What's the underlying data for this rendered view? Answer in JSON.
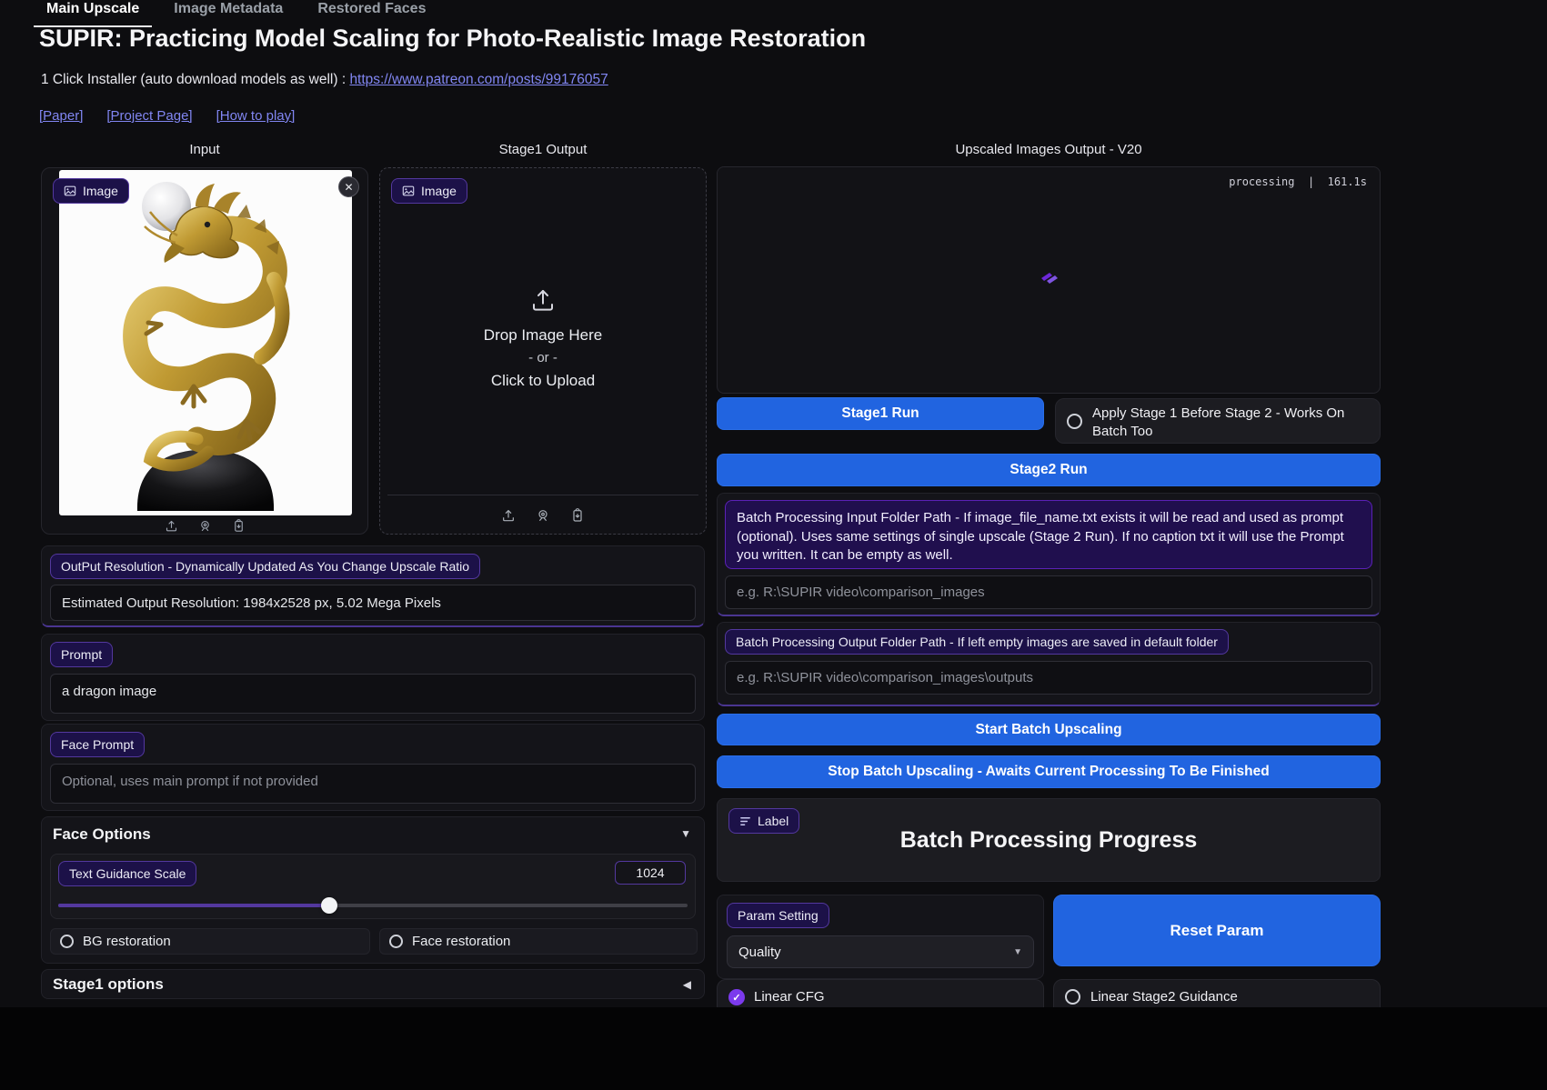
{
  "colors": {
    "accent_blue": "#2164e0",
    "accent_purple": "#7c3aed",
    "link": "#8186f2",
    "badge_bg": "#1c1148"
  },
  "tabs": [
    {
      "label": "Main Upscale",
      "active": true
    },
    {
      "label": "Image Metadata",
      "active": false
    },
    {
      "label": "Restored Faces",
      "active": false
    }
  ],
  "header": {
    "title": "SUPIR: Practicing Model Scaling for Photo-Realistic Image Restoration",
    "installer_text": "1 Click Installer (auto download models as well) : ",
    "installer_link": "https://www.patreon.com/posts/99176057",
    "links": [
      "[Paper]",
      "[Project Page]",
      "[How to play]"
    ]
  },
  "columns": {
    "input_label": "Input",
    "stage1_label": "Stage1 Output",
    "output_label": "Upscaled Images Output - V20"
  },
  "input_panel": {
    "badge": "Image"
  },
  "stage1_panel": {
    "badge": "Image",
    "drop_text": "Drop Image Here",
    "or_text": "- or -",
    "click_text": "Click to Upload"
  },
  "output_panel": {
    "status": "processing",
    "separator": "|",
    "time": "161.1s"
  },
  "resolution": {
    "badge": "OutPut Resolution - Dynamically Updated As You Change Upscale Ratio",
    "value": "Estimated Output Resolution: 1984x2528 px, 5.02 Mega Pixels"
  },
  "prompt": {
    "badge": "Prompt",
    "value": "a dragon image"
  },
  "face_prompt": {
    "badge": "Face Prompt",
    "placeholder": "Optional, uses main prompt if not provided"
  },
  "face_options": {
    "title": "Face Options",
    "tgs_badge": "Text Guidance Scale",
    "tgs_value": "1024",
    "slider_percent": 43,
    "bg_restoration": "BG restoration",
    "face_restoration": "Face restoration"
  },
  "stage1_options": {
    "title": "Stage1 options"
  },
  "buttons": {
    "stage1_run": "Stage1 Run",
    "stage2_run": "Stage2 Run",
    "start_batch": "Start Batch Upscaling",
    "stop_batch": "Stop Batch Upscaling - Awaits Current Processing To Be Finished",
    "reset_param": "Reset Param"
  },
  "apply_stage1": {
    "label": "Apply Stage 1 Before Stage 2 - Works On Batch Too"
  },
  "batch_input": {
    "info": "Batch Processing Input Folder Path - If image_file_name.txt exists it will be read and used as prompt (optional). Uses same settings of single upscale (Stage 2 Run). If no caption txt it will use the Prompt you written. It can be empty as well.",
    "placeholder": "e.g. R:\\SUPIR video\\comparison_images"
  },
  "batch_output": {
    "badge": "Batch Processing Output Folder Path - If left empty images are saved in default folder",
    "placeholder": "e.g. R:\\SUPIR video\\comparison_images\\outputs"
  },
  "progress": {
    "badge": "Label",
    "title": "Batch Processing Progress"
  },
  "param": {
    "badge": "Param Setting",
    "selected": "Quality"
  },
  "toggles": {
    "linear_cfg": "Linear CFG",
    "linear_stage2": "Linear Stage2 Guidance"
  }
}
